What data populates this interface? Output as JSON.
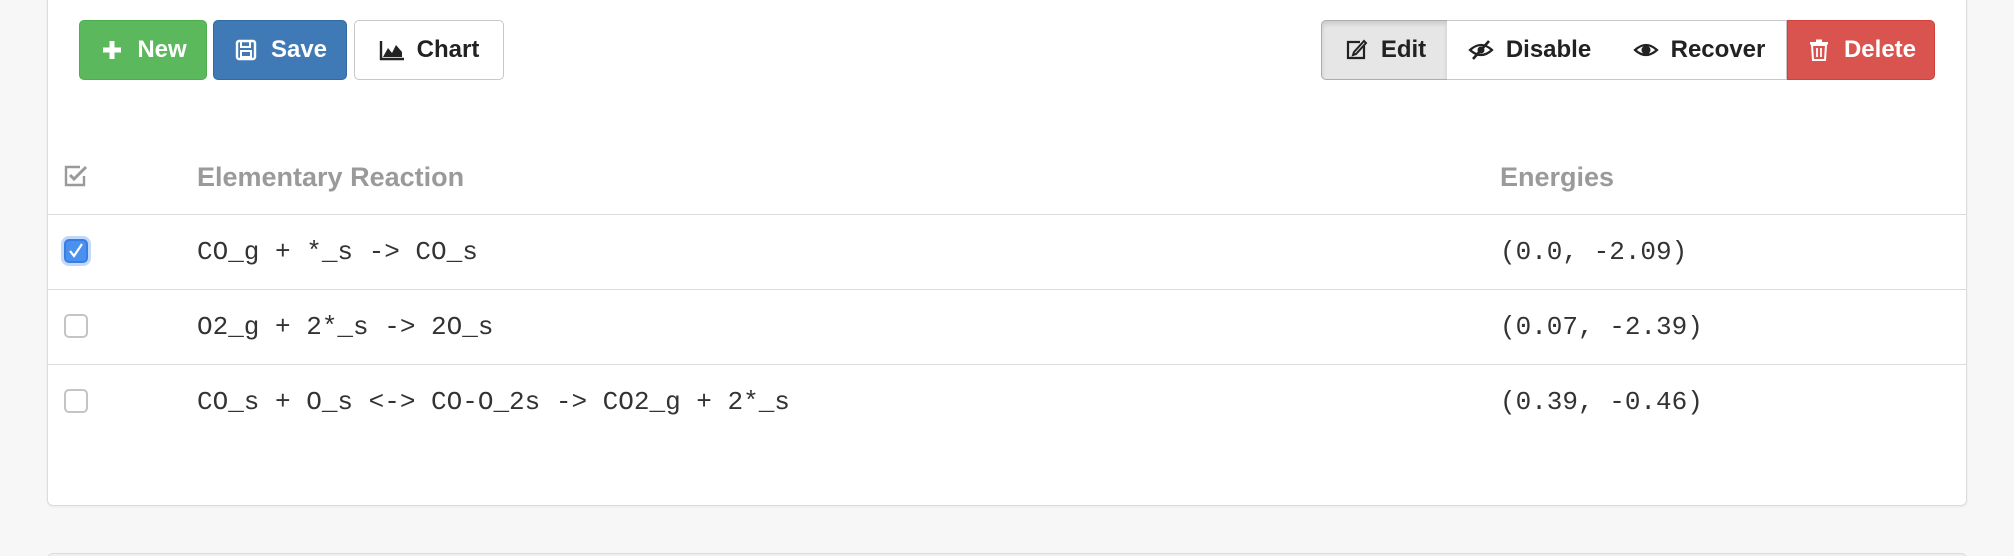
{
  "toolbar": {
    "new_label": "New",
    "save_label": "Save",
    "chart_label": "Chart",
    "edit_label": "Edit",
    "disable_label": "Disable",
    "recover_label": "Recover",
    "delete_label": "Delete"
  },
  "table": {
    "columns": [
      "Elementary Reaction",
      "Energies"
    ],
    "rows": [
      {
        "checked": true,
        "reaction": "CO_g + *_s -> CO_s",
        "energies": "(0.0, -2.09)"
      },
      {
        "checked": false,
        "reaction": "O2_g + 2*_s -> 2O_s",
        "energies": "(0.07, -2.39)"
      },
      {
        "checked": false,
        "reaction": "CO_s + O_s <-> CO-O_2s -> CO2_g + 2*_s",
        "energies": "(0.39, -0.46)"
      }
    ]
  },
  "colors": {
    "new": "#5cb85c",
    "save": "#3f7ab7",
    "delete": "#d9534f",
    "checkbox_checked": "#4a90f0",
    "header_text": "#9a9a9a"
  },
  "icons": {
    "new": "plus-icon",
    "save": "floppy-disk-icon",
    "chart": "area-chart-icon",
    "edit": "pencil-square-icon",
    "disable": "eye-slash-icon",
    "recover": "eye-icon",
    "delete": "trash-icon",
    "select_all": "check-square-icon"
  }
}
